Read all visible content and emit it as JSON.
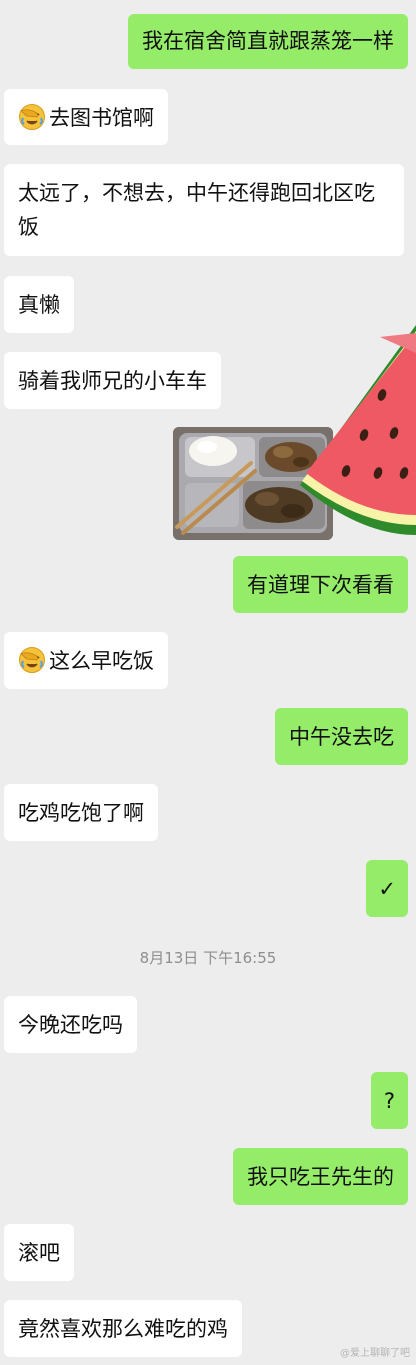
{
  "chat": {
    "messages": [
      {
        "side": "out",
        "text": "我在宿舍简直就跟蒸笼一样"
      },
      {
        "side": "in",
        "emoji": "facepalm-emoji",
        "text": "去图书馆啊"
      },
      {
        "side": "in",
        "text": "太远了，不想去，中午还得跑回北区吃饭"
      },
      {
        "side": "in",
        "text": "真懒"
      },
      {
        "side": "in",
        "text": "骑着我师兄的小车车"
      },
      {
        "side": "out",
        "kind": "image",
        "description": "photo of a cafeteria tray with rice and food, with a watermelon sticker"
      },
      {
        "side": "out",
        "text": "有道理下次看看"
      },
      {
        "side": "in",
        "emoji": "facepalm-emoji",
        "text": "这么早吃饭"
      },
      {
        "side": "out",
        "text": "中午没去吃"
      },
      {
        "side": "in",
        "text": "吃鸡吃饱了啊"
      },
      {
        "side": "out",
        "text": "✓"
      },
      {
        "side": "in",
        "text": "今晚还吃吗"
      },
      {
        "side": "out",
        "text": "?"
      },
      {
        "side": "out",
        "text": "我只吃王先生的"
      },
      {
        "side": "in",
        "text": "滚吧"
      },
      {
        "side": "in",
        "text": "竟然喜欢那么难吃的鸡"
      }
    ],
    "timestamp": "8月13日 下午16:55"
  },
  "watermark": "@爱上聊聊了吧",
  "colors": {
    "background": "#ededed",
    "incoming_bubble": "#ffffff",
    "outgoing_bubble": "#95ec69",
    "timestamp_text": "#8e8e8e"
  }
}
